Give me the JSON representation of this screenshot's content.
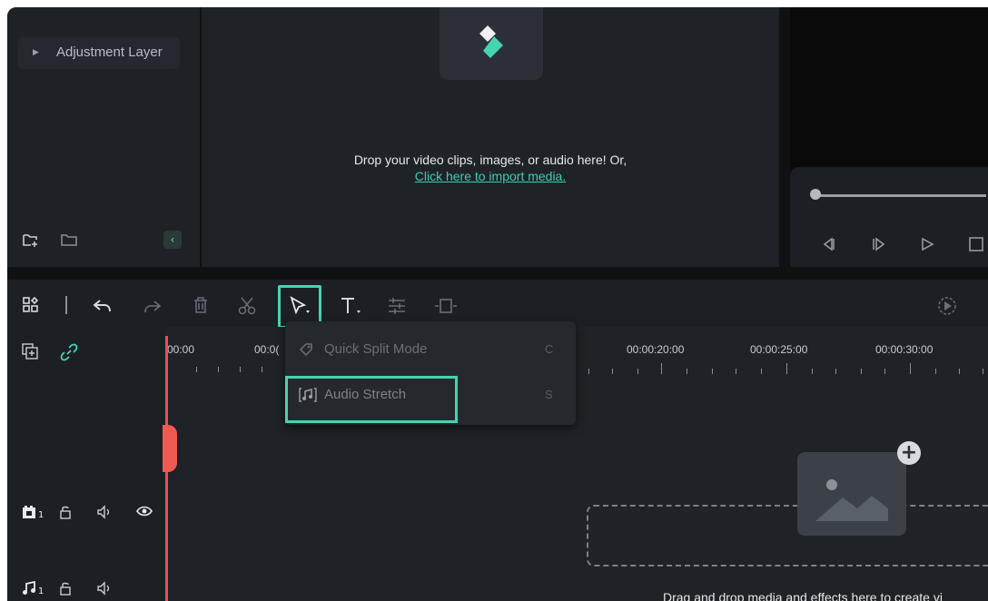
{
  "media_library": {
    "sidebar": {
      "items": [
        {
          "label": "Adjustment Layer"
        }
      ]
    },
    "drop_area": {
      "message": "Drop your video clips, images, or audio here! Or,",
      "import_link": "Click here to import media."
    }
  },
  "toolbar": {
    "select_tool_menu": {
      "items": [
        {
          "label": "Quick Split Mode",
          "shortcut": "C",
          "icon": "quick-split-icon"
        },
        {
          "label": "Audio Stretch",
          "shortcut": "S",
          "icon": "audio-stretch-icon"
        }
      ]
    }
  },
  "timeline": {
    "ruler_labels": [
      "00:00",
      "00:0(",
      "00:00:20:00",
      "00:00:25:00",
      "00:00:30:00"
    ],
    "tracks": [
      {
        "type": "video",
        "number": "1"
      },
      {
        "type": "audio",
        "number": "1"
      }
    ],
    "drop_hint": "Drag and drop media and effects here to create vi"
  },
  "colors": {
    "accent": "#45d4b2",
    "playhead": "#ef4f43",
    "link": "#3ccfb0"
  }
}
